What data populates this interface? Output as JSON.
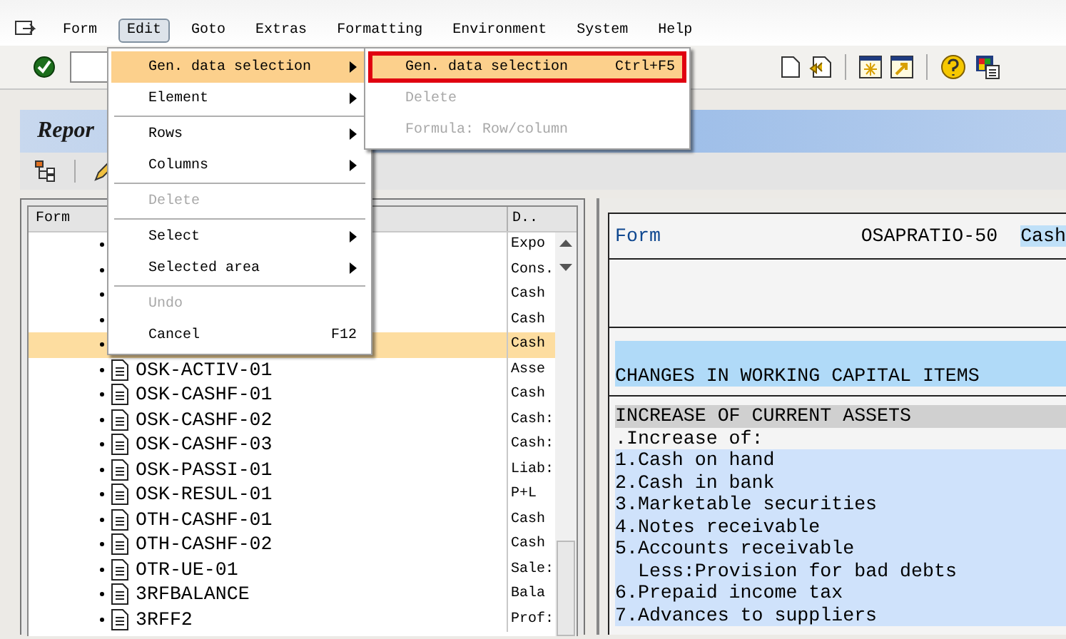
{
  "menubar": [
    {
      "label": "Form",
      "selected": false
    },
    {
      "label": "Edit",
      "selected": true
    },
    {
      "label": "Goto",
      "selected": false
    },
    {
      "label": "Extras",
      "selected": false
    },
    {
      "label": "Formatting",
      "selected": false
    },
    {
      "label": "Environment",
      "selected": false
    },
    {
      "label": "System",
      "selected": false
    },
    {
      "label": "Help",
      "selected": false
    }
  ],
  "edit_menu": [
    {
      "kind": "item",
      "label": "Gen. data selection",
      "submenu": true,
      "selected": true,
      "disabled": false
    },
    {
      "kind": "item",
      "label": "Element",
      "submenu": true,
      "selected": false,
      "disabled": false
    },
    {
      "kind": "separator"
    },
    {
      "kind": "item",
      "label": "Rows",
      "submenu": true,
      "selected": false,
      "disabled": false
    },
    {
      "kind": "item",
      "label": "Columns",
      "submenu": true,
      "selected": false,
      "disabled": false
    },
    {
      "kind": "separator"
    },
    {
      "kind": "item",
      "label": "Delete",
      "submenu": false,
      "selected": false,
      "disabled": true
    },
    {
      "kind": "separator"
    },
    {
      "kind": "item",
      "label": "Select",
      "submenu": true,
      "selected": false,
      "disabled": false
    },
    {
      "kind": "item",
      "label": "Selected area",
      "submenu": true,
      "selected": false,
      "disabled": false
    },
    {
      "kind": "separator"
    },
    {
      "kind": "item",
      "label": "Undo",
      "submenu": false,
      "selected": false,
      "disabled": true
    },
    {
      "kind": "item",
      "label": "Cancel",
      "shortcut": "F12",
      "submenu": false,
      "selected": false,
      "disabled": false
    }
  ],
  "sub_menu": [
    {
      "kind": "item",
      "label": "Gen. data selection",
      "shortcut": "Ctrl+F5",
      "submenu": false,
      "selected": true,
      "disabled": false,
      "outlined": true
    },
    {
      "kind": "item",
      "label": "Delete",
      "submenu": false,
      "selected": false,
      "disabled": true,
      "outlined": false
    },
    {
      "kind": "item",
      "label": "Formula: Row/column",
      "submenu": false,
      "selected": false,
      "disabled": true,
      "outlined": false
    }
  ],
  "title": "Repor",
  "tree": {
    "columns": [
      "Form",
      "D.."
    ],
    "rows": [
      {
        "description": "Expo",
        "selected": false
      },
      {
        "description": "Cons.",
        "selected": false
      },
      {
        "description": "Cash",
        "selected": false
      },
      {
        "description": "Cash",
        "selected": false
      },
      {
        "description": "Cash",
        "selected": true
      },
      {
        "name": "OSK-ACTIV-01",
        "description": "Asse",
        "selected": false
      },
      {
        "name": "OSK-CASHF-01",
        "description": "Cash",
        "selected": false
      },
      {
        "name": "OSK-CASHF-02",
        "description": "Cash:",
        "selected": false
      },
      {
        "name": "OSK-CASHF-03",
        "description": "Cash:",
        "selected": false
      },
      {
        "name": "OSK-PASSI-01",
        "description": "Liab:",
        "selected": false
      },
      {
        "name": "OSK-RESUL-01",
        "description": "P+L",
        "selected": false
      },
      {
        "name": "OTH-CASHF-01",
        "description": "Cash",
        "selected": false
      },
      {
        "name": "OTH-CASHF-02",
        "description": "Cash",
        "selected": false
      },
      {
        "name": "OTR-UE-01",
        "description": "Sale:",
        "selected": false
      },
      {
        "name": "3RFBALANCE",
        "description": "Bala",
        "selected": false
      },
      {
        "name": "3RFF2",
        "description": "Prof:",
        "selected": false
      }
    ]
  },
  "form_view": {
    "label": "Form",
    "value": "OSAPRATIO-50",
    "extra": "Cash",
    "section_title": "CHANGES IN WORKING CAPITAL ITEMS",
    "lines": [
      {
        "kind": "heading",
        "text": "INCREASE OF CURRENT ASSETS"
      },
      {
        "kind": "plain",
        "text": ".Increase of:"
      },
      {
        "kind": "item",
        "text": "1.Cash on hand"
      },
      {
        "kind": "item",
        "text": "2.Cash in bank"
      },
      {
        "kind": "item",
        "text": "3.Marketable securities"
      },
      {
        "kind": "item",
        "text": "4.Notes receivable"
      },
      {
        "kind": "item",
        "text": "5.Accounts receivable"
      },
      {
        "kind": "subitem",
        "text": "Less:Provision for bad debts"
      },
      {
        "kind": "item",
        "text": "6.Prepaid income tax"
      },
      {
        "kind": "item",
        "text": "7.Advances to suppliers"
      }
    ]
  }
}
